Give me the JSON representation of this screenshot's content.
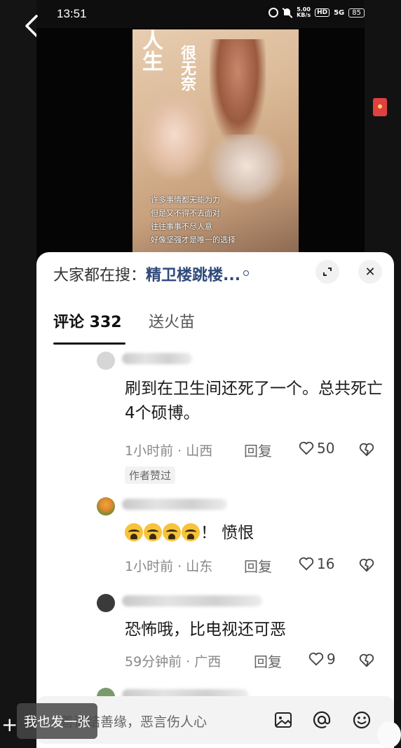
{
  "status_bar": {
    "time": "13:51",
    "speed_top": "5.00",
    "speed_unit": "KB/s",
    "hd": "HD",
    "network": "5G",
    "battery": "85"
  },
  "video": {
    "poster_title_a": "人生",
    "poster_title_b": "很无奈",
    "poster_lines": [
      "许多事情都无能为力",
      "但是又不得不去面对",
      "往往事事不尽人意",
      "好像坚强才是唯一的选择"
    ]
  },
  "panel": {
    "search_label": "大家都在搜：",
    "search_query": "精卫楼跳楼...",
    "close_glyph": "✕"
  },
  "tabs": [
    {
      "label": "评论 332"
    },
    {
      "label": "送火苗"
    }
  ],
  "comments": [
    {
      "text": "刷到在卫生间还死了一个。总共死亡4个硕博。",
      "meta": "1小时前 · 山西",
      "reply": "回复",
      "likes": "50",
      "tag": "作者赞过"
    },
    {
      "text_suffix": "！ 愤恨",
      "meta": "1小时前 · 山东",
      "reply": "回复",
      "likes": "16"
    },
    {
      "text": "恐怖哦，比电视还可恶",
      "meta": "59分钟前 · 广西",
      "reply": "回复",
      "likes": "9"
    }
  ],
  "input_bar": {
    "overlay_label": "我也发一张",
    "placeholder": "善语结善缘，恶言伤人心"
  },
  "icons": {
    "back": "chevron-left-icon",
    "expand": "expand-icon",
    "close": "close-icon",
    "heart": "heart-icon",
    "dislike": "broken-heart-icon",
    "image": "image-icon",
    "mention": "at-icon",
    "emoji": "emoji-icon"
  },
  "colors": {
    "search_link": "#2f4a7a",
    "panel_bg": "#ffffff",
    "red_envelope": "#e04040"
  }
}
